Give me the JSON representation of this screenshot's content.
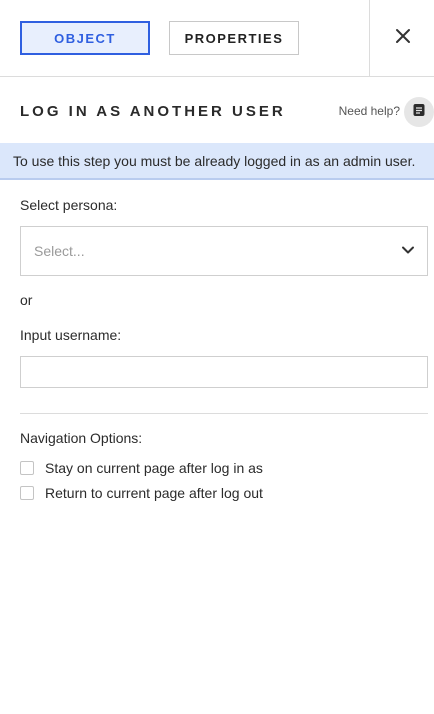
{
  "tabs": {
    "object": "OBJECT",
    "properties": "PROPERTIES"
  },
  "header": {
    "title": "LOG IN AS ANOTHER USER",
    "help_label": "Need help?"
  },
  "banner": {
    "text": "To use this step you must be already logged in as an admin user."
  },
  "form": {
    "persona_label": "Select persona:",
    "persona_placeholder": "Select...",
    "or_text": "or",
    "username_label": "Input username:",
    "username_value": "",
    "nav_label": "Navigation Options:",
    "options": [
      {
        "label": "Stay on current page after log in as",
        "checked": false
      },
      {
        "label": "Return to current page after log out",
        "checked": false
      }
    ]
  },
  "colors": {
    "accent": "#2f5fe0",
    "accent_bg": "#e8effd",
    "banner_bg": "#dbe7fb"
  },
  "icons": {
    "close": "close-icon",
    "help": "document-icon",
    "dropdown": "chevron-down-icon"
  }
}
